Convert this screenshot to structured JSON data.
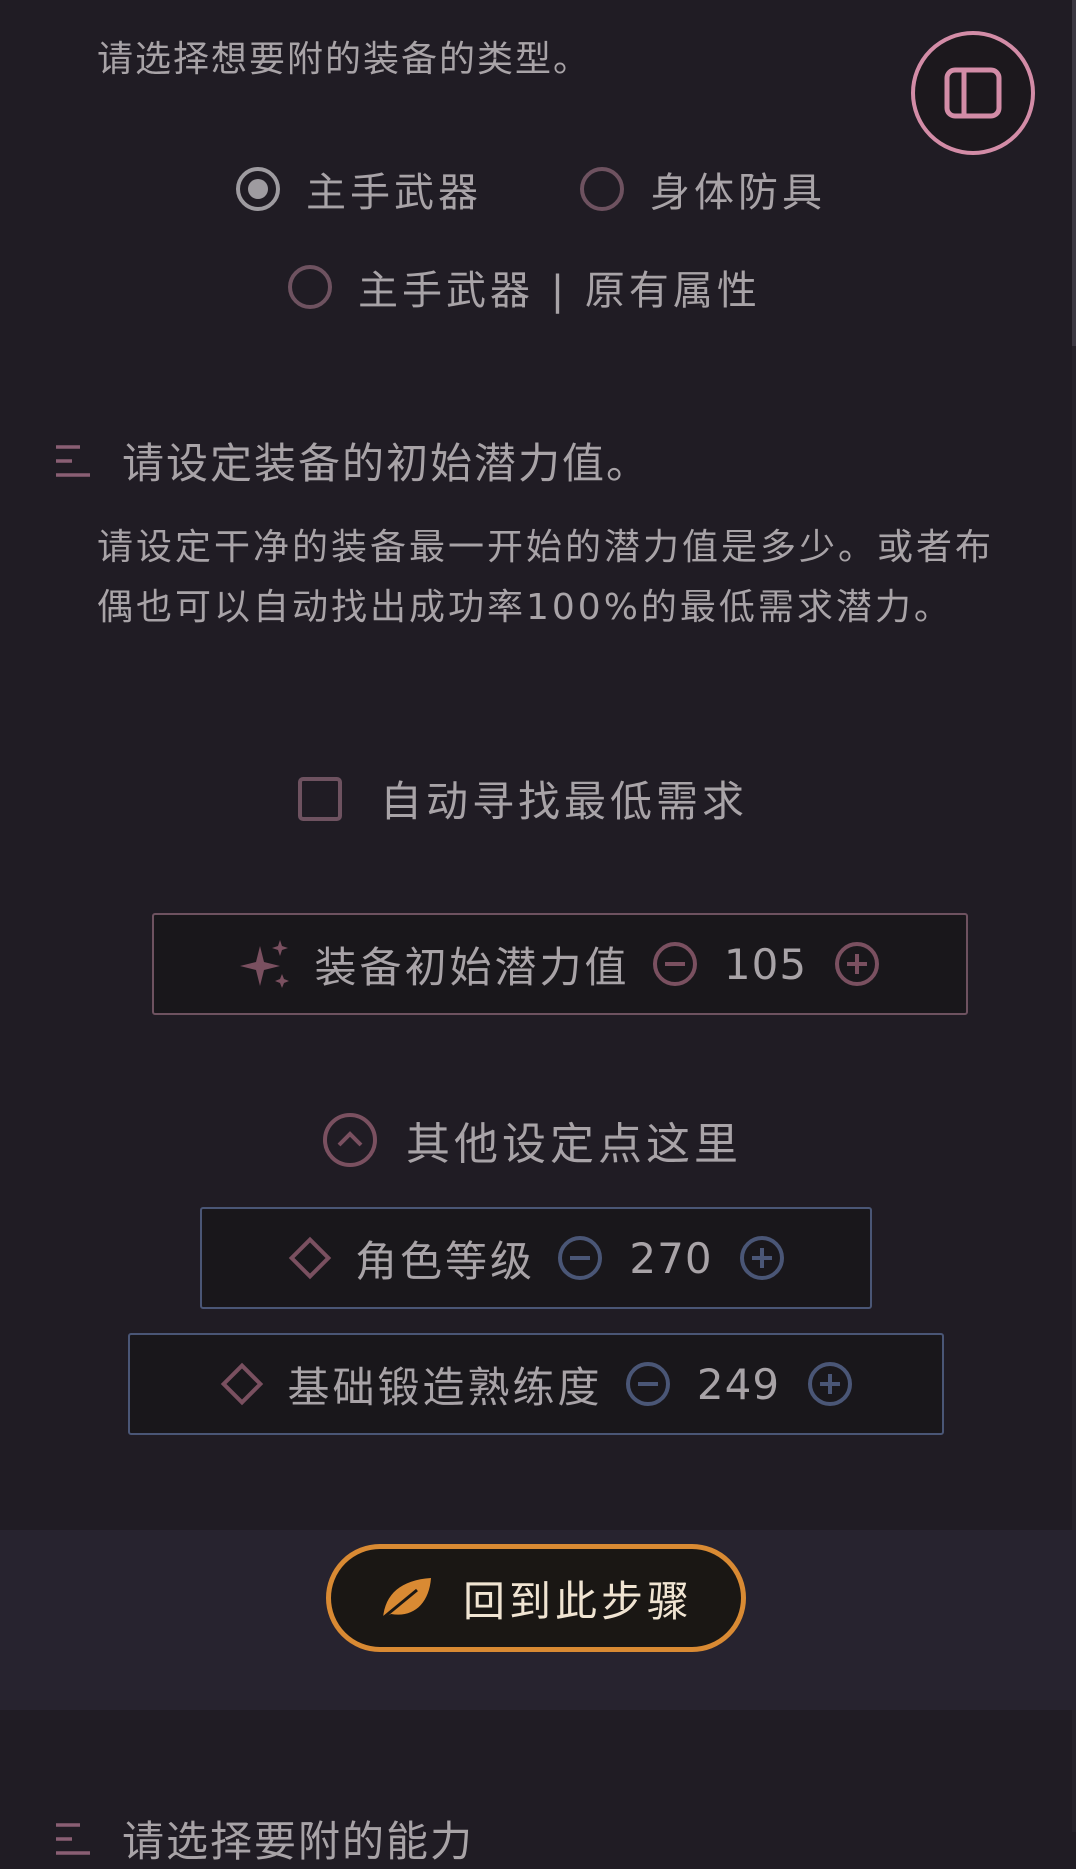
{
  "equip_type": {
    "prompt": "请选择想要附的装备的类型。",
    "options": [
      {
        "label": "主手武器",
        "checked": true
      },
      {
        "label": "身体防具",
        "checked": false
      },
      {
        "label": "主手武器 | 原有属性",
        "checked": false
      }
    ]
  },
  "potential": {
    "section_title": "请设定装备的初始潜力值。",
    "description": "请设定干净的装备最一开始的潜力值是多少。或者布偶也可以自动找出成功率100%的最低需求潜力。",
    "auto_find_label": "自动寻找最低需求",
    "auto_find_checked": false,
    "initial": {
      "label": "装备初始潜力值",
      "value": "105"
    }
  },
  "other_settings": {
    "toggle_label": "其他设定点这里",
    "character_level": {
      "label": "角色等级",
      "value": "270"
    },
    "forging_proficiency": {
      "label": "基础锻造熟练度",
      "value": "249"
    }
  },
  "footer": {
    "back_button_label": "回到此步骤",
    "next_section_title": "请选择要附的能力"
  },
  "colors": {
    "background": "#201c24",
    "accent_pink": "#d38ca7",
    "accent_orange": "#d98a33",
    "muted_border": "#6e5260",
    "blue_border": "#4a5676"
  },
  "icons": {
    "sidebar": "sidebar-toggle-icon",
    "list": "list-icon",
    "sparkle": "sparkle-icon",
    "diamond": "diamond-icon",
    "minus": "minus-circle-icon",
    "plus": "plus-circle-icon",
    "chevron": "chevron-up-circle-icon",
    "leaf": "leaf-icon"
  }
}
